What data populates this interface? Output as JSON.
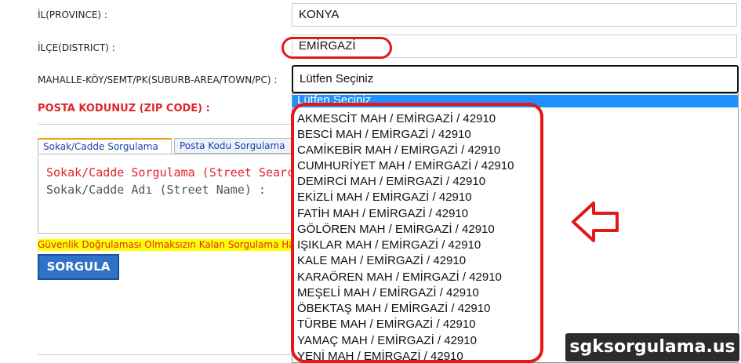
{
  "form": {
    "province_label": "İL(PROVINCE) :",
    "province_value": "KONYA",
    "district_label": "İLÇE(DISTRICT) :",
    "district_value": "EMİRGAZİ",
    "neighborhood_label": "MAHALLE-KÖY/SEMT/PK(SUBURB-AREA/TOWN/PC) :",
    "neighborhood_value": "Lütfen Seçiniz",
    "zip_label": "POSTA KODUNUZ (ZIP CODE) :"
  },
  "tabs": [
    {
      "label": "Sokak/Cadde Sorgulama"
    },
    {
      "label": "Posta Kodu Sorgulama"
    }
  ],
  "street_panel": {
    "title": "Sokak/Cadde Sorgulama (Street Search)",
    "field_label": "Sokak/Cadde Adı (Street Name) :"
  },
  "warning_text": "Güvenlik Doğrulaması Olmaksızın Kalan Sorgulama Hakkınız",
  "search_button": "SORGULA",
  "dropdown": {
    "selected": "Lütfen Seçiniz",
    "options": [
      "AKMESCİT MAH / EMİRGAZİ / 42910",
      "BESCİ MAH / EMİRGAZİ / 42910",
      "CAMİKEBİR MAH / EMİRGAZİ / 42910",
      "CUMHURİYET MAH / EMİRGAZİ / 42910",
      "DEMİRCİ MAH / EMİRGAZİ / 42910",
      "EKİZLİ MAH / EMİRGAZİ / 42910",
      "FATİH MAH / EMİRGAZİ / 42910",
      "GÖLÖREN MAH / EMİRGAZİ / 42910",
      "IŞIKLAR MAH / EMİRGAZİ / 42910",
      "KALE MAH / EMİRGAZİ / 42910",
      "KARAÖREN MAH / EMİRGAZİ / 42910",
      "MEŞELİ MAH / EMİRGAZİ / 42910",
      "ÖBEKTAŞ MAH / EMİRGAZİ / 42910",
      "TÜRBE MAH / EMİRGAZİ / 42910",
      "YAMAÇ MAH / EMİRGAZİ / 42910",
      "YENİ MAH / EMİRGAZİ / 42910"
    ]
  },
  "annotation": {
    "arrow_icon": "left-arrow-outline-icon",
    "color": "#e21919"
  },
  "watermark": "sgksorgulama.us"
}
